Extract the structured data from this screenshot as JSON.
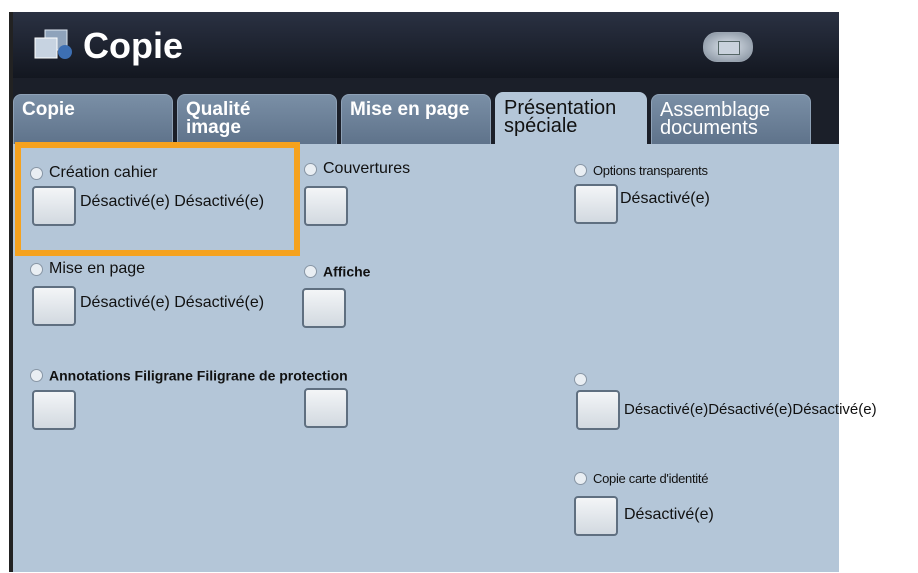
{
  "title": "Copie",
  "tabs": [
    {
      "label": "Copie"
    },
    {
      "label": "Qualité\nimage"
    },
    {
      "label": "Mise en page"
    },
    {
      "label": "Présentation\nspéciale"
    },
    {
      "label": "Assemblage\ndocuments"
    }
  ],
  "options": {
    "creation_cahier": {
      "label": "Création cahier",
      "value": "Désactivé(e) Désactivé(e)"
    },
    "couvertures": {
      "label": "Couvertures"
    },
    "options_transparents": {
      "label": "Options transparents",
      "value": "Désactivé(e)"
    },
    "mise_en_page": {
      "label": "Mise en page",
      "value": "Désactivé(e) Désactivé(e)"
    },
    "affiche": {
      "label": "Affiche"
    },
    "annotations": {
      "label": "Annotations Filigrane Filigrane de protection"
    },
    "unnamed": {
      "label": "",
      "value": "Désactivé(e)Désactivé(e)Désactivé(e)"
    },
    "copie_carte": {
      "label": "Copie carte d'identité",
      "value": "Désactivé(e)"
    }
  },
  "colors": {
    "highlight": "#f6a21e",
    "panel": "#b4c6d8",
    "titlebar": "#131720"
  }
}
